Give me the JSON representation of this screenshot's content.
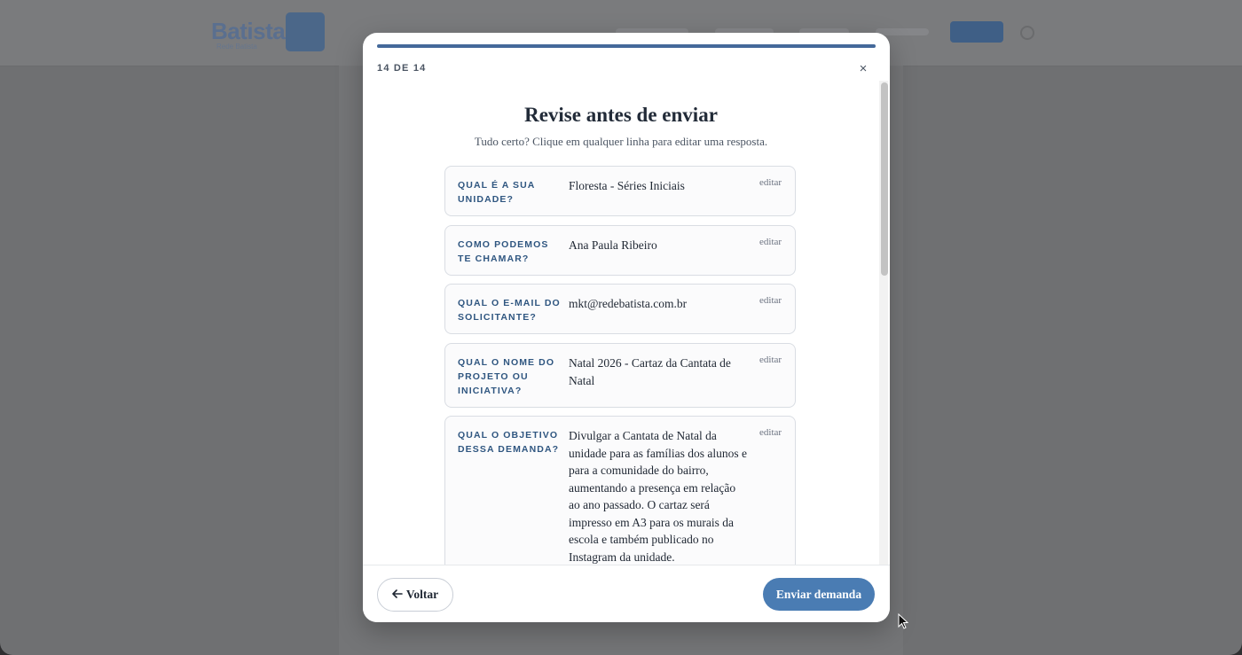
{
  "modal": {
    "progress": 1.0,
    "step_label": "14 DE 14",
    "close_glyph": "×",
    "title": "Revise antes de enviar",
    "subtitle": "Tudo certo? Clique em qualquer linha para editar uma resposta.",
    "rows": [
      {
        "question": "QUAL É A SUA UNIDADE?",
        "answer": "Floresta - Séries Iniciais",
        "edit_label": "editar"
      },
      {
        "question": "COMO PODEMOS TE CHAMAR?",
        "answer": "Ana Paula Ribeiro",
        "edit_label": "editar"
      },
      {
        "question": "QUAL O E-MAIL DO SOLICITANTE?",
        "answer": "mkt@redebatista.com.br",
        "edit_label": "editar"
      },
      {
        "question": "QUAL O NOME DO PROJETO OU INICIATIVA?",
        "answer": "Natal 2026 - Cartaz da Cantata de Natal",
        "edit_label": "editar"
      },
      {
        "question": "QUAL O OBJETIVO DESSA DEMANDA?",
        "answer": "Divulgar a Cantata de Natal da unidade para as famílias dos alunos e para a comunidade do bairro, aumentando a presença em relação ao ano passado. O cartaz será impresso em A3 para os murais da escola e também publicado no Instagram da unidade.",
        "edit_label": "editar"
      }
    ],
    "back_label": "Voltar",
    "back_icon": "arrow-left-icon",
    "send_label": "Enviar demanda"
  },
  "header": {
    "logo_word": "Batista",
    "logo_sub": "Rede Batista"
  },
  "colors": {
    "accent": "#4a7cb3",
    "progress": "#44699a",
    "question_text": "#2f5680",
    "overlay": "#6f7072"
  }
}
